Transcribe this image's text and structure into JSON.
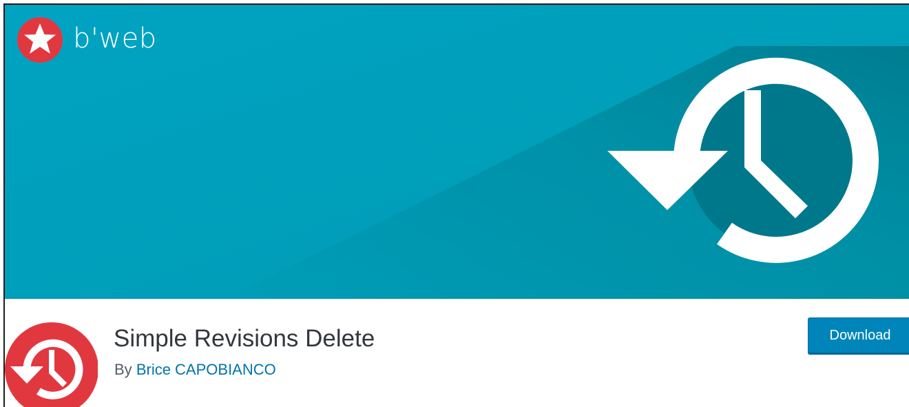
{
  "banner": {
    "brand_name": "b'web",
    "brand_logo_icon": "star-icon",
    "hero_icon": "history-clock-icon"
  },
  "plugin": {
    "icon": "history-clock-icon",
    "title": "Simple Revisions Delete",
    "byline_prefix": "By",
    "author": "Brice CAPOBIANCO"
  },
  "actions": {
    "download_label": "Download"
  },
  "colors": {
    "banner_teal": "#00a0bc",
    "icon_red": "#e1383f",
    "button_blue": "#0085ba",
    "link_blue": "#0073aa"
  }
}
